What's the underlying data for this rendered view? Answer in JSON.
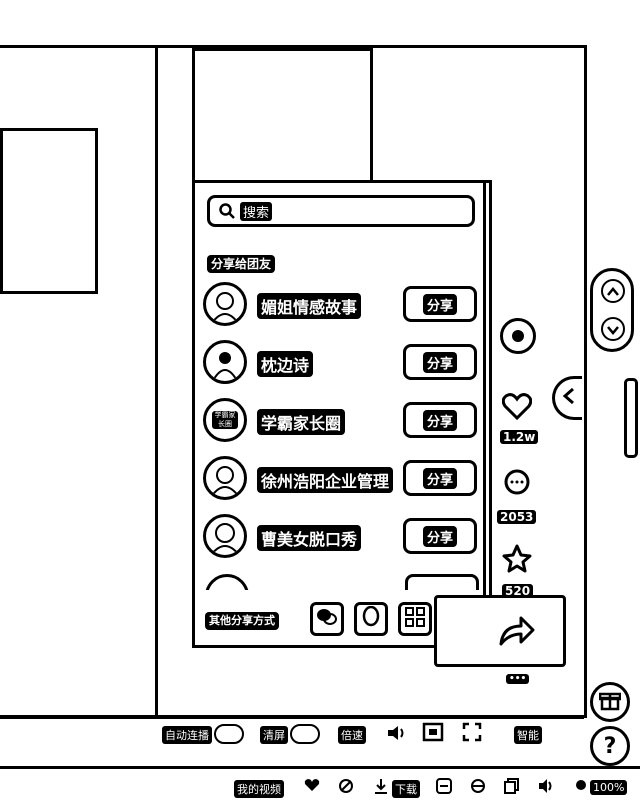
{
  "share_panel": {
    "search_placeholder": "搜索",
    "section_title": "分享给团友",
    "friends": [
      {
        "name": "媚姐情感故事",
        "share_label": "分享"
      },
      {
        "name": "枕边诗",
        "share_label": "分享"
      },
      {
        "name": "学霸家长圈",
        "share_label": "分享",
        "avatar_text": "学霸家长圈"
      },
      {
        "name": "徐州浩阳企业管理",
        "share_label": "分享"
      },
      {
        "name": "曹美女脱口秀",
        "share_label": "分享"
      }
    ],
    "other_share_label": "其他分享方式"
  },
  "side_rail": {
    "like_count": "1.2w",
    "comment_count": "2053",
    "favorite_count": "520",
    "more_label": "•••"
  },
  "player_bar": {
    "autoplay_label": "自动连播",
    "clear_screen_label": "清屏",
    "speed_label": "倍速",
    "quality_label": "智能"
  },
  "status_bar": {
    "my_videos_label": "我的视频",
    "download_label": "下载",
    "zoom_label": "100%"
  },
  "icons": [
    "search-icon",
    "wechat-icon",
    "qq-icon",
    "qrcode-icon",
    "link-icon",
    "share-arrow-icon",
    "heart-icon",
    "comment-icon",
    "star-icon",
    "chevron-up-icon",
    "chevron-down-icon",
    "chevron-left-icon",
    "gift-icon",
    "help-icon",
    "volume-icon",
    "fullscreen-icon"
  ]
}
